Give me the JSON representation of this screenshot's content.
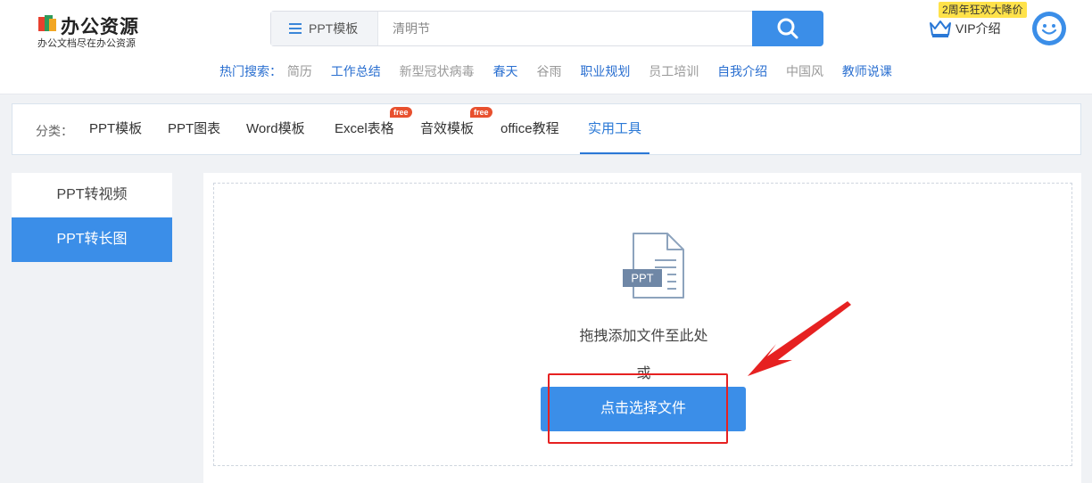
{
  "header": {
    "logo_title": "办公资源",
    "logo_subtitle": "办公文档尽在办公资源",
    "search_type": "PPT模板",
    "search_placeholder": "清明节",
    "hot_label": "热门搜索：",
    "hot_items": [
      {
        "text": "简历",
        "color": "#999999"
      },
      {
        "text": "工作总结",
        "color": "#2a6fd0"
      },
      {
        "text": "新型冠状病毒",
        "color": "#999999"
      },
      {
        "text": "春天",
        "color": "#2a6fd0"
      },
      {
        "text": "谷雨",
        "color": "#999999"
      },
      {
        "text": "职业规划",
        "color": "#2a6fd0"
      },
      {
        "text": "员工培训",
        "color": "#999999"
      },
      {
        "text": "自我介绍",
        "color": "#2a6fd0"
      },
      {
        "text": "中国风",
        "color": "#999999"
      },
      {
        "text": "教师说课",
        "color": "#2a6fd0"
      }
    ],
    "promo": "2周年狂欢大降价",
    "vip_label": "VIP介绍"
  },
  "categories": {
    "label": "分类：",
    "items": [
      {
        "label": "PPT模板",
        "active": false,
        "badge": ""
      },
      {
        "label": "PPT图表",
        "active": false,
        "badge": ""
      },
      {
        "label": "Word模板",
        "active": false,
        "badge": ""
      },
      {
        "label": "Excel表格",
        "active": false,
        "badge": "free"
      },
      {
        "label": "音效模板",
        "active": false,
        "badge": "free"
      },
      {
        "label": "office教程",
        "active": false,
        "badge": ""
      },
      {
        "label": "实用工具",
        "active": true,
        "badge": ""
      }
    ]
  },
  "sidebar": {
    "items": [
      {
        "label": "PPT转视频",
        "active": false
      },
      {
        "label": "PPT转长图",
        "active": true
      }
    ]
  },
  "upload": {
    "file_badge": "PPT",
    "drop_text": "拖拽添加文件至此处",
    "or_text": "或",
    "button_label": "点击选择文件"
  },
  "colors": {
    "primary": "#3b8ee8",
    "link_blue": "#2a6fd0",
    "annotation_red": "#e62121",
    "promo_yellow": "#ffe24a",
    "free_badge": "#e8502e"
  }
}
